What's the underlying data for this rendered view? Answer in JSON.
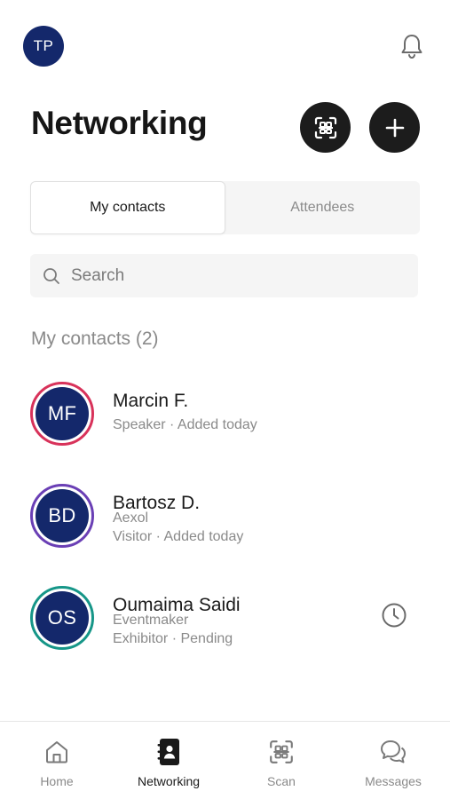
{
  "header": {
    "avatar_initials": "TP",
    "title": "Networking"
  },
  "tabs": [
    {
      "label": "My contacts",
      "active": true
    },
    {
      "label": "Attendees",
      "active": false
    }
  ],
  "search": {
    "placeholder": "Search",
    "value": ""
  },
  "section": {
    "title": "My contacts (2)"
  },
  "contacts": [
    {
      "initials": "MF",
      "name": "Marcin F.",
      "line1": "Speaker · Added today",
      "line2": "",
      "ring_color": "#d8325a",
      "pending": false
    },
    {
      "initials": "BD",
      "name": "Bartosz D.",
      "line1": "Aexol",
      "line2": "Visitor · Added today",
      "ring_color": "#6a3fb5",
      "pending": false
    },
    {
      "initials": "OS",
      "name": "Oumaima Saidi",
      "line1": "Eventmaker",
      "line2": "Exhibitor · Pending",
      "ring_color": "#169688",
      "pending": true
    }
  ],
  "nav": [
    {
      "label": "Home",
      "icon": "home-icon",
      "active": false
    },
    {
      "label": "Networking",
      "icon": "contacts-book-icon",
      "active": true
    },
    {
      "label": "Scan",
      "icon": "scan-icon",
      "active": false
    },
    {
      "label": "Messages",
      "icon": "chat-bubbles-icon",
      "active": false
    }
  ],
  "colors": {
    "avatar_bg": "#14286b",
    "dark_button": "#1c1c1c",
    "muted_text": "#8a8a8a"
  }
}
